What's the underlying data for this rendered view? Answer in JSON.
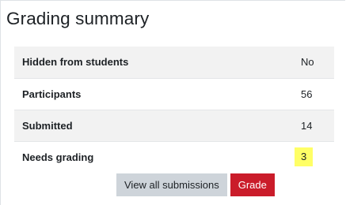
{
  "heading": "Grading summary",
  "summary": {
    "rows": [
      {
        "label": "Hidden from students",
        "value": "No"
      },
      {
        "label": "Participants",
        "value": "56"
      },
      {
        "label": "Submitted",
        "value": "14"
      },
      {
        "label": "Needs grading",
        "value": "3"
      }
    ]
  },
  "actions": {
    "view_all_label": "View all submissions",
    "grade_label": "Grade"
  },
  "colors": {
    "highlight": "#ffff66",
    "primary": "#ca1c2a",
    "secondary": "#ced4da",
    "stripe": "#f2f2f2"
  }
}
